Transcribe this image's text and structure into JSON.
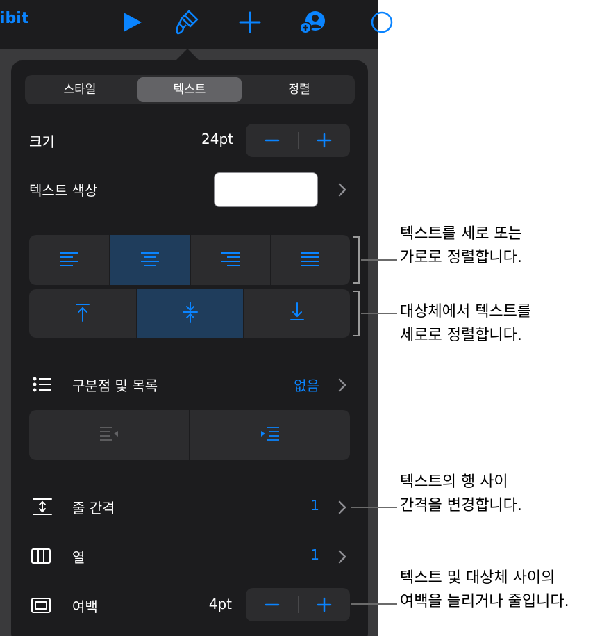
{
  "toolbar": {
    "partial_title": "ibit",
    "icons": [
      "play-icon",
      "paintbrush-icon",
      "plus-icon",
      "collaborate-icon",
      "more-icon"
    ]
  },
  "tabs": [
    {
      "label": "스타일",
      "active": false
    },
    {
      "label": "텍스트",
      "active": true
    },
    {
      "label": "정렬",
      "active": false
    }
  ],
  "size": {
    "label": "크기",
    "value": "24pt"
  },
  "text_color": {
    "label": "텍스트 색상",
    "swatch": "#ffffff"
  },
  "horizontal_align": {
    "options": [
      "left",
      "center",
      "right",
      "justify"
    ],
    "selected": "center"
  },
  "vertical_align": {
    "options": [
      "top",
      "middle",
      "bottom"
    ],
    "selected": "middle"
  },
  "bullets": {
    "label": "구분점 및 목록",
    "value": "없음"
  },
  "line_spacing": {
    "label": "줄 간격",
    "value": "1"
  },
  "columns": {
    "label": "열",
    "value": "1"
  },
  "margin": {
    "label": "여백",
    "value": "4pt"
  },
  "callouts": {
    "align_text": [
      "텍스트를 세로 또는",
      "가로로 정렬합니다."
    ],
    "vertical": [
      "대상체에서 텍스트를",
      "세로로 정렬합니다."
    ],
    "spacing": [
      "텍스트의 행 사이",
      "간격을 변경합니다."
    ],
    "margin": [
      "텍스트 및 대상체 사이의",
      "여백을 늘리거나 줄입니다."
    ]
  },
  "colors": {
    "accent": "#0a84ff",
    "panel": "#1c1c1e",
    "control": "#2c2c2e",
    "selected": "#1f3d5c"
  }
}
